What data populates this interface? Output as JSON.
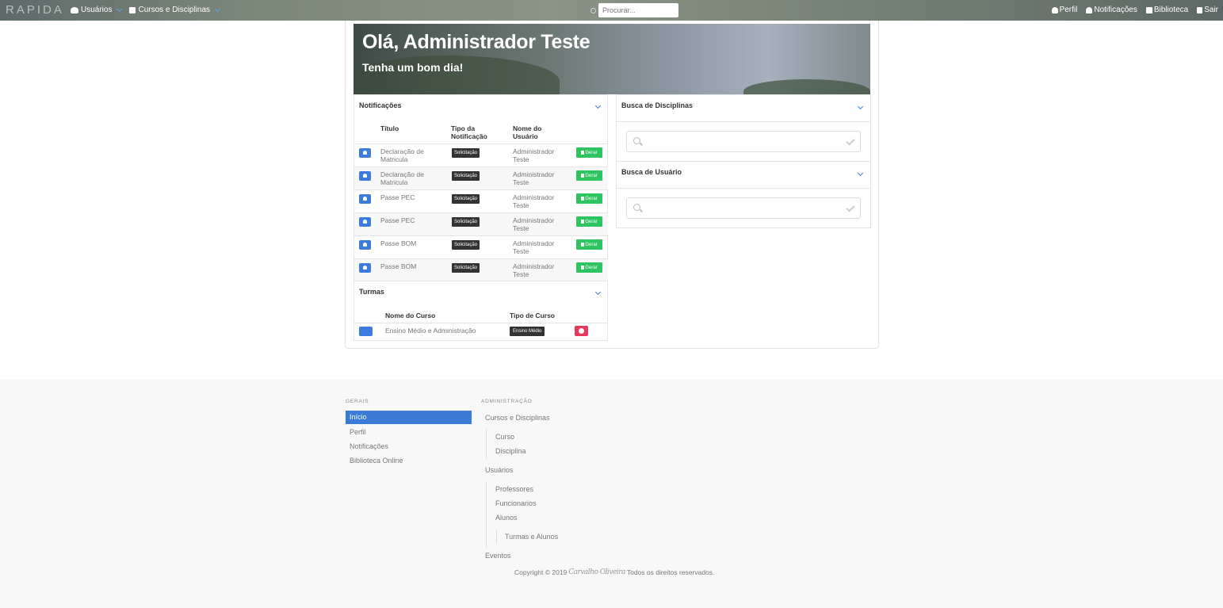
{
  "navbar": {
    "brand": "RAPIDA",
    "users": "Usuários",
    "courses": "Cursos e Disciplinas",
    "search_placeholder": "Procurar...",
    "profile": "Perfil",
    "notifications": "Notificações",
    "library": "Biblioteca",
    "logout": "Sair"
  },
  "hero": {
    "greeting": "Olá, Administrador Teste",
    "subtitle": "Tenha um bom dia!"
  },
  "notifications": {
    "title": "Notificações",
    "headers": [
      "Título",
      "Tipo da Notificação",
      "Nome do Usuário"
    ],
    "rows": [
      {
        "title": "Declaração de Matricula",
        "type": "Solicitação",
        "user": "Administrador Teste",
        "action": "Gerar"
      },
      {
        "title": "Declaração de Matricula",
        "type": "Solicitação",
        "user": "Administrador Teste",
        "action": "Gerar"
      },
      {
        "title": "Passe PEC",
        "type": "Solicitação",
        "user": "Administrador Teste",
        "action": "Gerar"
      },
      {
        "title": "Passe PEC",
        "type": "Solicitação",
        "user": "Administrador Teste",
        "action": "Gerar"
      },
      {
        "title": "Passe BOM",
        "type": "Solicitação",
        "user": "Administrador Teste",
        "action": "Gerar"
      },
      {
        "title": "Passe BOM",
        "type": "Solicitação",
        "user": "Administrador Teste",
        "action": "Gerar"
      }
    ]
  },
  "turmas": {
    "title": "Turmas",
    "headers": [
      "Nome do Curso",
      "Tipo de Curso"
    ],
    "rows": [
      {
        "course": "Ensino Médio e Administração",
        "type": "Ensino Médio"
      }
    ]
  },
  "search_disciplines": {
    "title": "Busca de Disciplinas"
  },
  "search_users": {
    "title": "Busca de Usuário"
  },
  "footer": {
    "general_heading": "GERAIS",
    "general_links": [
      "Início",
      "Perfil",
      "Notificações",
      "Biblioteca Online"
    ],
    "admin_heading": "ADMINISTRAÇÃO",
    "admin_courses": "Cursos e Disciplinas",
    "admin_course": "Curso",
    "admin_discipline": "Disciplina",
    "admin_users": "Usuários",
    "admin_teachers": "Professores",
    "admin_staff": "Funcionarios",
    "admin_students": "Alunos",
    "admin_classes": "Turmas e Alunos",
    "admin_events": "Eventos",
    "copyright_pre": "Copyright © 2019",
    "copyright_post": "Todos os direitos reservados.",
    "signature": "Carvalho Oliveira"
  },
  "colors": {
    "primary": "#3a7bd5",
    "success": "#2ec45f",
    "danger": "#e8375a",
    "dark": "#333333"
  }
}
